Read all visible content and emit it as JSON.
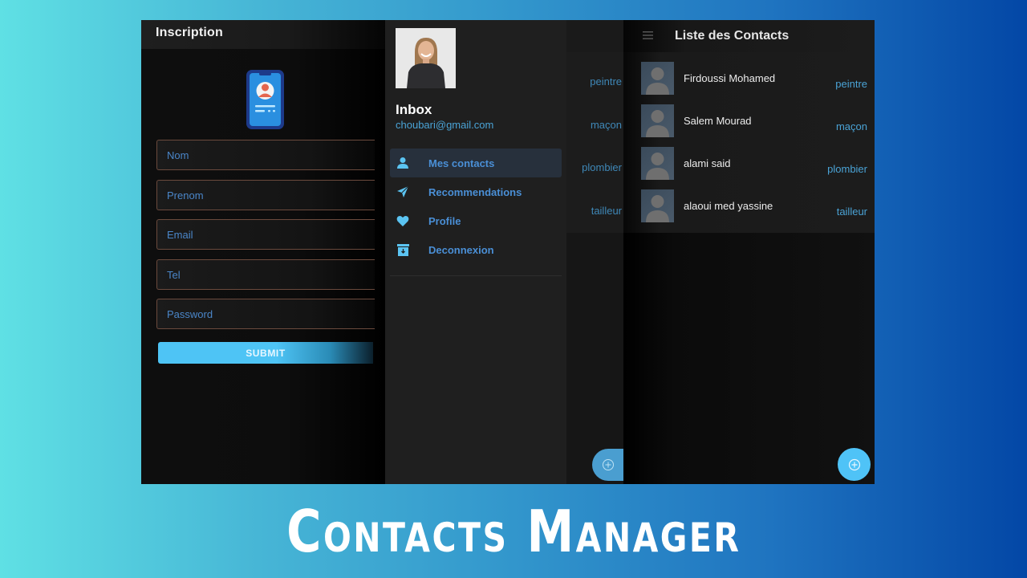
{
  "banner": {
    "title": "Contacts Manager"
  },
  "inscription": {
    "title": "Inscription",
    "logo_icon": "contact-phone-icon",
    "fields": [
      {
        "name": "nom",
        "placeholder": "Nom",
        "value": ""
      },
      {
        "name": "prenom",
        "placeholder": "Prenom",
        "value": ""
      },
      {
        "name": "email",
        "placeholder": "Email",
        "value": ""
      },
      {
        "name": "tel",
        "placeholder": "Tel",
        "value": ""
      },
      {
        "name": "password",
        "placeholder": "Password",
        "value": ""
      }
    ],
    "submit_label": "SUBMIT"
  },
  "drawer": {
    "user_name": "Inbox",
    "user_email": "choubari@gmail.com",
    "items": [
      {
        "label": "Mes contacts",
        "icon": "person-icon",
        "active": true
      },
      {
        "label": "Recommendations",
        "icon": "send-icon",
        "active": false
      },
      {
        "label": "Profile",
        "icon": "heart-icon",
        "active": false
      },
      {
        "label": "Deconnexion",
        "icon": "archive-icon",
        "active": false
      }
    ]
  },
  "background_list": {
    "tags": [
      "peintre",
      "maçon",
      "plombier",
      "tailleur"
    ]
  },
  "contacts": {
    "title": "Liste des Contacts",
    "menu_icon": "hamburger-menu-icon",
    "items": [
      {
        "name": "Firdoussi Mohamed",
        "profession": "peintre"
      },
      {
        "name": "Salem Mourad",
        "profession": "maçon"
      },
      {
        "name": "alami said",
        "profession": "plombier"
      },
      {
        "name": "alaoui med yassine",
        "profession": "tailleur"
      }
    ],
    "fab_icon": "add-circle-icon"
  },
  "colors": {
    "accent": "#4fc3f7",
    "link": "#4a8fd6",
    "field_border": "#6b4a3d"
  }
}
